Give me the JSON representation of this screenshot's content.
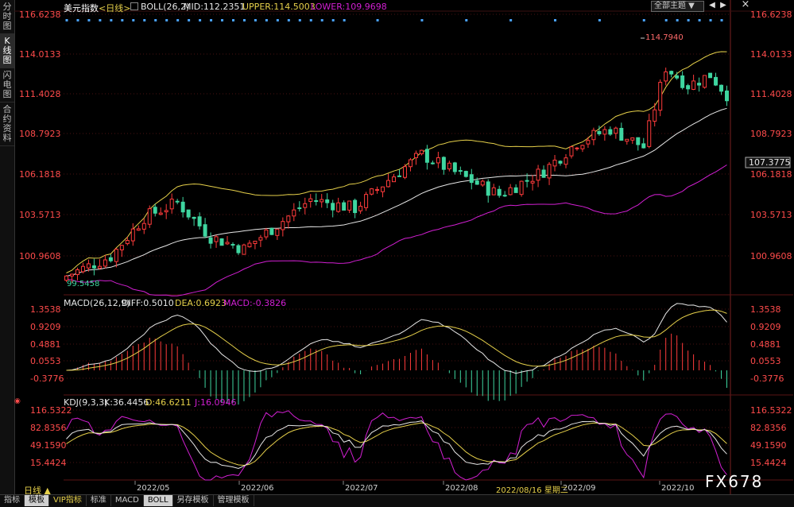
{
  "sidebar": [
    "分时图",
    "K线图",
    "闪电图",
    "合约资料"
  ],
  "header": {
    "instrument": "美元指数",
    "period": "<日线>",
    "boll_label": "BOLL(26,2)",
    "mid": "MID:112.2351",
    "upper": "UPPER:114.5003",
    "lower": "LOWER:109.9698",
    "theme_select": "全部主题 ▼",
    "theme_prev": "◀",
    "theme_next": "▶",
    "close_icon": "×"
  },
  "price_axis": [
    "116.6238",
    "114.0133",
    "111.4028",
    "108.7923",
    "106.1818",
    "103.5713",
    "100.9608"
  ],
  "current_price": "107.3775",
  "annotations": {
    "high": "114.7940",
    "low": "99.5458"
  },
  "macd": {
    "title": "MACD(26,12,9)",
    "diff": "DIFF:0.5010",
    "dea": "DEA:0.6923",
    "macd": "MACD:-0.3826",
    "axis": [
      "1.3538",
      "0.9209",
      "0.4881",
      "0.0553",
      "-0.3776"
    ]
  },
  "kdj": {
    "title": "KDJ(9,3,3)",
    "k": "K:36.4456",
    "d": "D:46.6211",
    "j": "J:16.0946",
    "axis": [
      "116.5322",
      "82.8356",
      "49.1590",
      "15.4424"
    ]
  },
  "time_axis": [
    "2022/05",
    "2022/06",
    "2022/07",
    "2022/08",
    "2022/09",
    "2022/10"
  ],
  "cursor_date": "2022/08/16 星期二",
  "period_button": "日线 ▲",
  "bottom_tabs": [
    "指标",
    "模板",
    "VIP指标",
    "标准",
    "MACD",
    "BOLL",
    "另存模板",
    "管理模板"
  ],
  "watermark": "FX678",
  "colors": {
    "up": "#ff3b3b",
    "down": "#3fd6a0",
    "mid": "#e6e6e6",
    "upper": "#e6d04a",
    "lower": "#d21fd2",
    "axis_text": "#ff4b4b"
  }
}
